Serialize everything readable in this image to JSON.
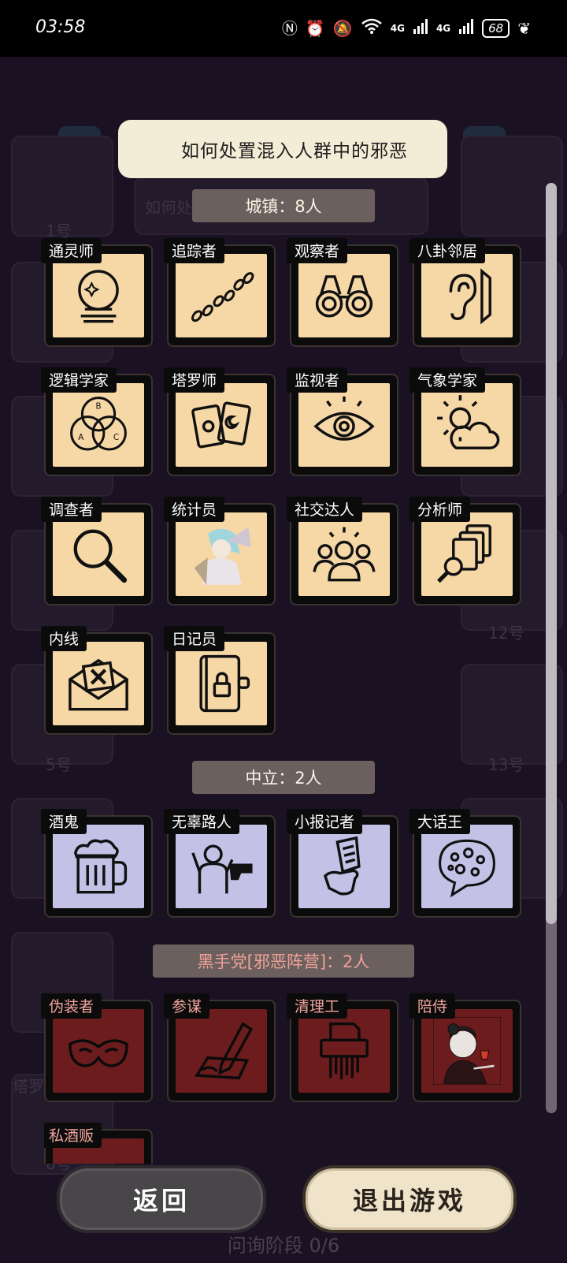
{
  "status_bar": {
    "time": "03:58",
    "icons": [
      "nfc-icon",
      "alarm-icon",
      "mute-icon",
      "wifi-icon",
      "signal-icon",
      "signal-icon"
    ],
    "wifi_label": "6",
    "net1": "4G",
    "net2": "4G",
    "battery": "68"
  },
  "background": {
    "ghost_labels": [
      "1号",
      "5号",
      "8号",
      "12号",
      "13号",
      "塔罗"
    ],
    "ghost_question": "如何处",
    "ghost_footer": "问询阶段 0/6"
  },
  "dialog": {
    "title": "如何处置混入人群中的邪恶"
  },
  "sections": {
    "town": {
      "header": "城镇：8人"
    },
    "neutral": {
      "header": "中立：2人"
    },
    "evil": {
      "header": "黑手党[邪恶阵营]：2人"
    }
  },
  "roles": {
    "town": [
      {
        "label": "通灵师",
        "icon": "crystal-ball-icon"
      },
      {
        "label": "追踪者",
        "icon": "footprints-icon"
      },
      {
        "label": "观察者",
        "icon": "binoculars-icon"
      },
      {
        "label": "八卦邻居",
        "icon": "ear-icon"
      },
      {
        "label": "逻辑学家",
        "icon": "venn-diagram-icon"
      },
      {
        "label": "塔罗师",
        "icon": "tarot-cards-icon"
      },
      {
        "label": "监视者",
        "icon": "eye-icon"
      },
      {
        "label": "气象学家",
        "icon": "weather-icon"
      },
      {
        "label": "调查者",
        "icon": "magnifier-icon"
      },
      {
        "label": "统计员",
        "icon": "character-portrait"
      },
      {
        "label": "社交达人",
        "icon": "crowd-icon"
      },
      {
        "label": "分析师",
        "icon": "documents-search-icon"
      },
      {
        "label": "内线",
        "icon": "envelope-x-icon"
      },
      {
        "label": "日记员",
        "icon": "locked-diary-icon"
      }
    ],
    "neutral": [
      {
        "label": "酒鬼",
        "icon": "beer-mug-icon"
      },
      {
        "label": "无辜路人",
        "icon": "hostage-icon"
      },
      {
        "label": "小报记者",
        "icon": "newspaper-icon"
      },
      {
        "label": "大话王",
        "icon": "speech-bubble-icon"
      }
    ],
    "evil": [
      {
        "label": "伪装者",
        "icon": "mask-icon"
      },
      {
        "label": "参谋",
        "icon": "pen-writing-icon"
      },
      {
        "label": "清理工",
        "icon": "shredder-icon"
      },
      {
        "label": "陪侍",
        "icon": "character-portrait"
      },
      {
        "label": "私酒贩",
        "icon": "bottle-icon"
      }
    ]
  },
  "buttons": {
    "back": "返回",
    "exit": "退出游戏"
  },
  "colors": {
    "town_card": "#f6d7a6",
    "neutral_card": "#c4c1e7",
    "evil_card": "#6d1c1e",
    "title_bg": "#f3ecd6"
  }
}
